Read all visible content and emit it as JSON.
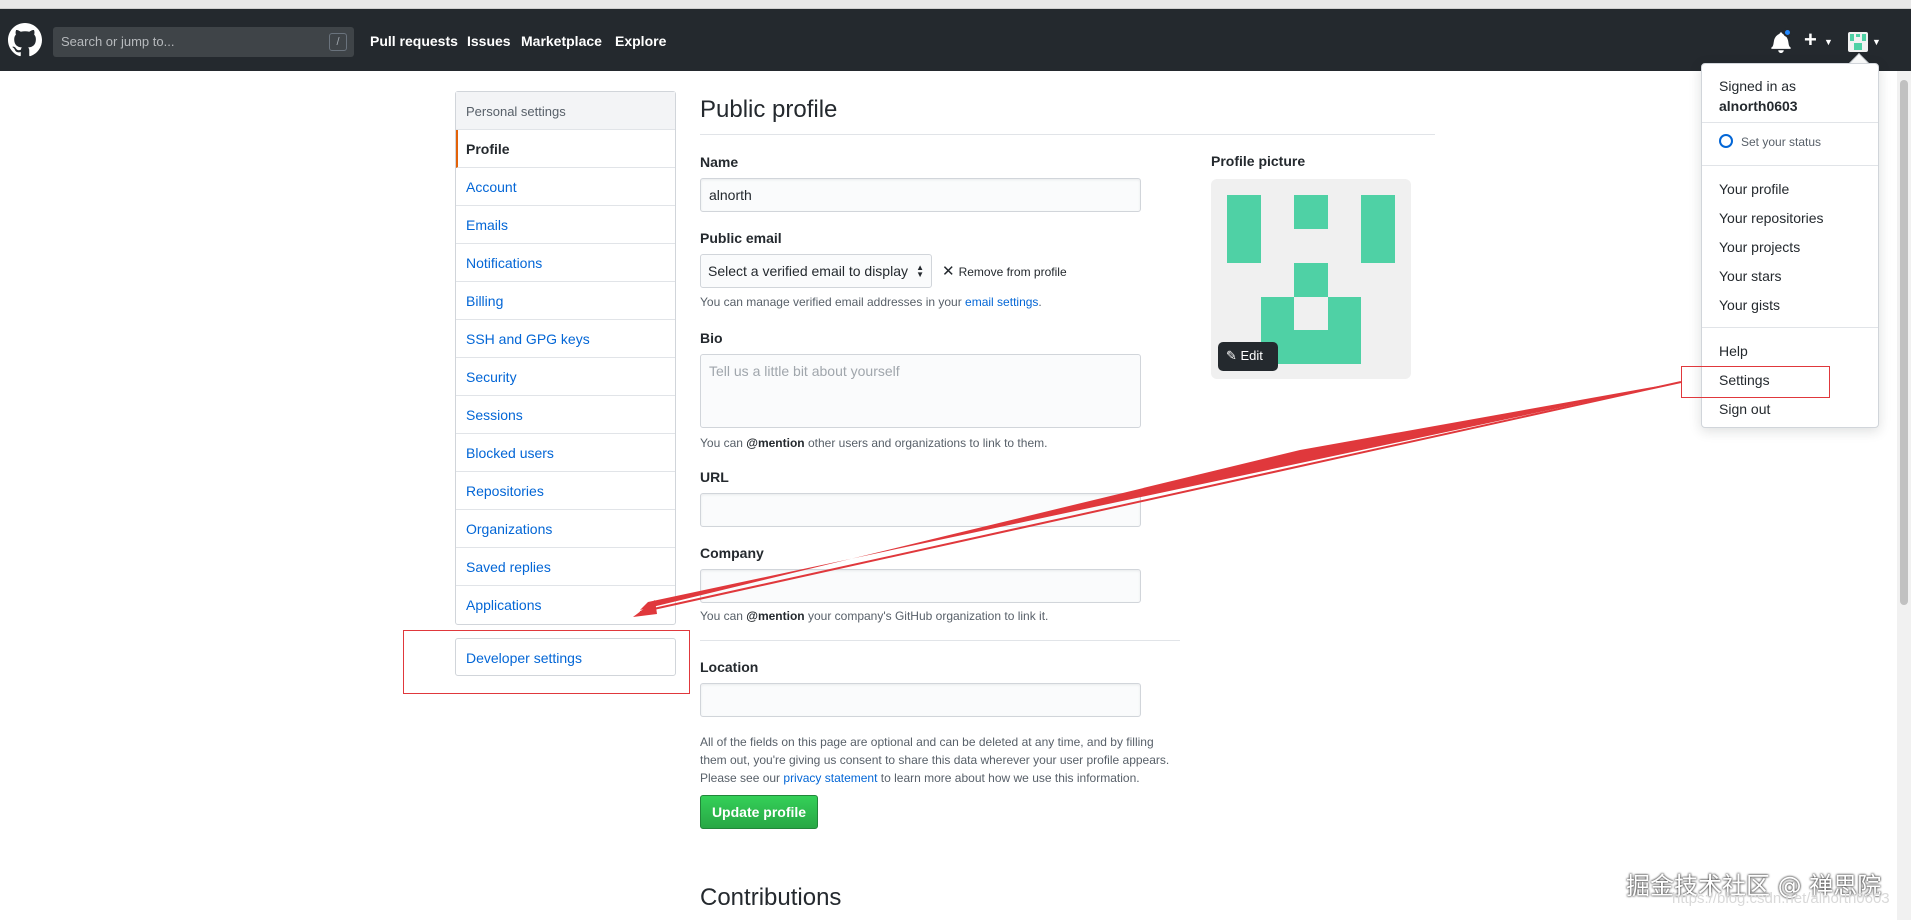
{
  "header": {
    "search_placeholder": "Search or jump to...",
    "slash_key": "/",
    "nav": [
      "Pull requests",
      "Issues",
      "Marketplace",
      "Explore"
    ],
    "plus": "+"
  },
  "sidebar": {
    "heading": "Personal settings",
    "items": [
      "Profile",
      "Account",
      "Emails",
      "Notifications",
      "Billing",
      "SSH and GPG keys",
      "Security",
      "Sessions",
      "Blocked users",
      "Repositories",
      "Organizations",
      "Saved replies",
      "Applications"
    ],
    "developer": "Developer settings"
  },
  "main": {
    "title": "Public profile",
    "name_label": "Name",
    "name_value": "alnorth",
    "email_label": "Public email",
    "email_select": "Select a verified email to display",
    "remove": "Remove from profile",
    "email_note_pre": "You can manage verified email addresses in your ",
    "email_note_link": "email settings",
    "email_note_post": ".",
    "bio_label": "Bio",
    "bio_placeholder": "Tell us a little bit about yourself",
    "bio_note_pre": "You can ",
    "bio_note_mention": "@mention",
    "bio_note_post": " other users and organizations to link to them.",
    "url_label": "URL",
    "company_label": "Company",
    "company_note_pre": "You can ",
    "company_note_mention": "@mention",
    "company_note_post": " your company's GitHub organization to link it.",
    "location_label": "Location",
    "footer_note_1": "All of the fields on this page are optional and can be deleted at any time, and by filling",
    "footer_note_2": "them out, you're giving us consent to share this data wherever your user profile appears.",
    "footer_note_3_pre": "Please see our ",
    "footer_note_3_link": "privacy statement",
    "footer_note_3_post": " to learn more about how we use this information.",
    "update_button": "Update profile",
    "contributions": "Contributions"
  },
  "profile_picture": {
    "label": "Profile picture",
    "edit": "Edit",
    "color": "#4fd1a5"
  },
  "dropdown": {
    "signed_in_as": "Signed in as",
    "username": "alnorth0603",
    "set_status": "Set your status",
    "group1": [
      "Your profile",
      "Your repositories",
      "Your projects",
      "Your stars",
      "Your gists"
    ],
    "group2": [
      "Help",
      "Settings",
      "Sign out"
    ]
  },
  "watermark": "掘金技术社区 @ 禅思院",
  "watermark_url": "https://blog.csdn.net/alnorth0603",
  "colors": {
    "header": "#24292e",
    "link": "#0366d6",
    "annotation": "#e0383c",
    "button": "#28a745"
  }
}
